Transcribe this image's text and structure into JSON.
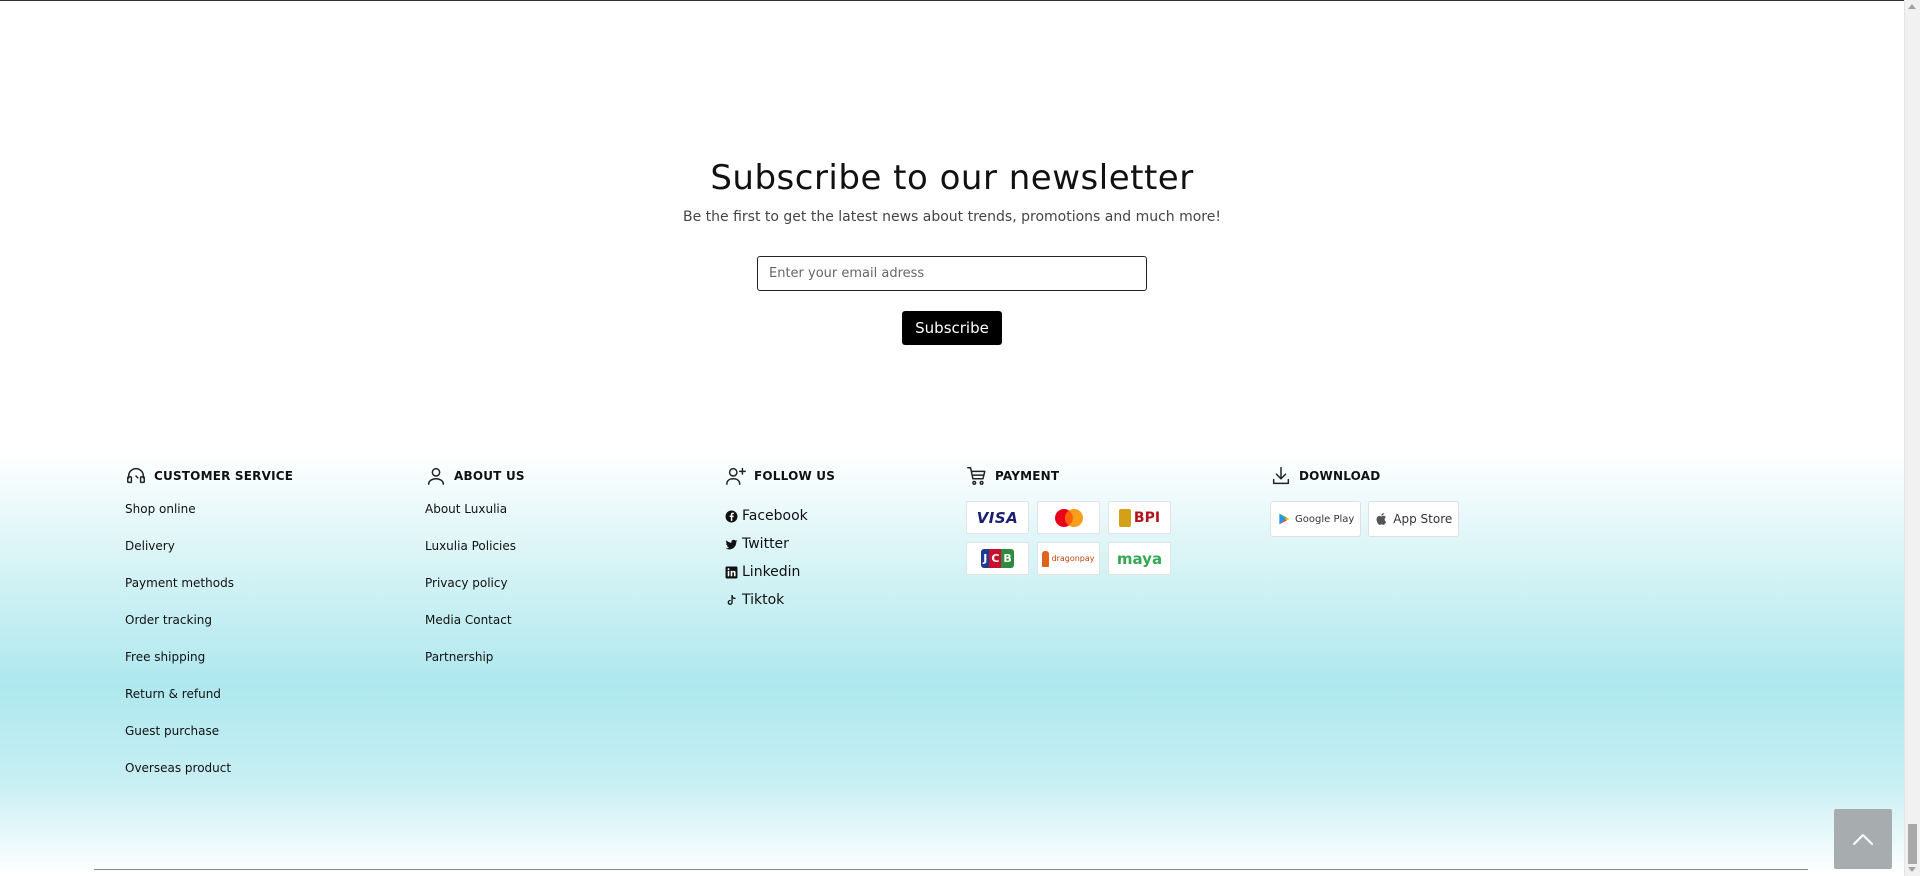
{
  "newsletter": {
    "title": "Subscribe to our newsletter",
    "subtitle": "Be the first to get the latest news about trends, promotions and much more!",
    "email_placeholder": "Enter your email adress",
    "subscribe_label": "Subscribe"
  },
  "footer": {
    "customer_service": {
      "heading": "CUSTOMER SERVICE",
      "icon": "headset-icon",
      "items": [
        "Shop online",
        "Delivery",
        "Payment methods",
        "Order tracking",
        "Free shipping",
        "Return & refund",
        "Guest purchase",
        "Overseas product"
      ]
    },
    "about_us": {
      "heading": "ABOUT US",
      "icon": "user-icon",
      "items": [
        "About Luxulia",
        "Luxulia Policies",
        "Privacy policy",
        "Media Contact",
        "Partnership"
      ]
    },
    "follow_us": {
      "heading": "FOLLOW US",
      "icon": "user-plus-icon",
      "items": [
        {
          "label": "Facebook",
          "icon": "facebook-icon"
        },
        {
          "label": "Twitter",
          "icon": "twitter-icon"
        },
        {
          "label": "Linkedin",
          "icon": "linkedin-icon"
        },
        {
          "label": "Tiktok",
          "icon": "tiktok-icon"
        }
      ]
    },
    "payment": {
      "heading": "PAYMENT",
      "icon": "cart-icon",
      "methods": [
        {
          "label": "VISA",
          "color": "#1a1f71"
        },
        {
          "label": "",
          "name": "mastercard"
        },
        {
          "label": "BPI",
          "color": "#b0151b"
        },
        {
          "label": "JCB",
          "color": "#1a3d8f"
        },
        {
          "label": "dragonpay",
          "color": "#c2410c"
        },
        {
          "label": "maya",
          "color": "#34a853"
        }
      ]
    },
    "download": {
      "heading": "DOWNLOAD",
      "icon": "download-icon",
      "stores": [
        {
          "label": "Google Play",
          "icon": "google-play-icon"
        },
        {
          "label": "App Store",
          "icon": "apple-icon"
        }
      ]
    }
  },
  "colors": {
    "accent_teal": "#aee8ee",
    "button_black": "#000000",
    "back_to_top": "#a7adae"
  }
}
